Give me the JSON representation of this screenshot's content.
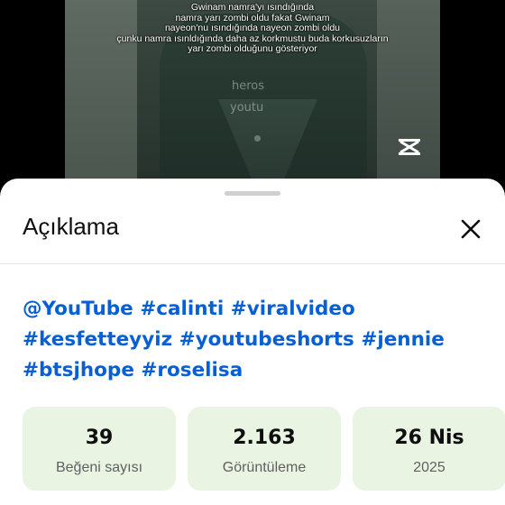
{
  "video": {
    "subtitle_lines": [
      "Gwinam namra'yı ısındığında",
      "namra yarı zombi oldu fakat Gwinam",
      "nayeon'nu ısındığında nayeon zombi oldu",
      "çunku namra ısınldığında daha az korkmustu buda korkusuzların",
      "yarı zombi olduğunu gösteriyor"
    ],
    "watermark_1": "heros",
    "watermark_2": "youtu",
    "logo_icon": "capcut-icon"
  },
  "sheet": {
    "title": "Açıklama",
    "close_icon": "close-icon",
    "tags": [
      "@YouTube",
      "#calinti",
      "#viralvideo",
      "#kesfetteyyiz",
      "#youtubeshorts",
      "#jennie",
      "#btsjhope",
      "#roselisa"
    ],
    "stats": [
      {
        "value": "39",
        "label": "Beğeni sayısı"
      },
      {
        "value": "2.163",
        "label": "Görüntüleme"
      },
      {
        "value": "26 Nis",
        "label": "2025"
      }
    ],
    "colors": {
      "link": "#065fd4",
      "stat_bg": "#eaf4e2"
    }
  }
}
